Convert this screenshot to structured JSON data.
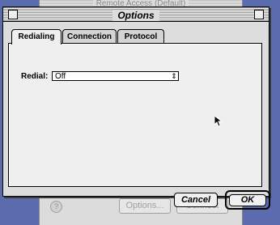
{
  "background_window": {
    "title": "Remote Access (Default)",
    "help_glyph": "?",
    "options_label": "Options...",
    "connect_label": "Connect"
  },
  "dialog": {
    "title": "Options",
    "tabs": [
      {
        "label": "Redialing",
        "selected": true
      },
      {
        "label": "Connection",
        "selected": false
      },
      {
        "label": "Protocol",
        "selected": false
      }
    ],
    "redial_label": "Redial:",
    "redial_value": "Off",
    "cancel_label": "Cancel",
    "ok_label": "OK"
  },
  "colors": {
    "desktop": "#5a6cae",
    "dialog_bg": "#dddddd",
    "panel_bg": "#efefef"
  }
}
